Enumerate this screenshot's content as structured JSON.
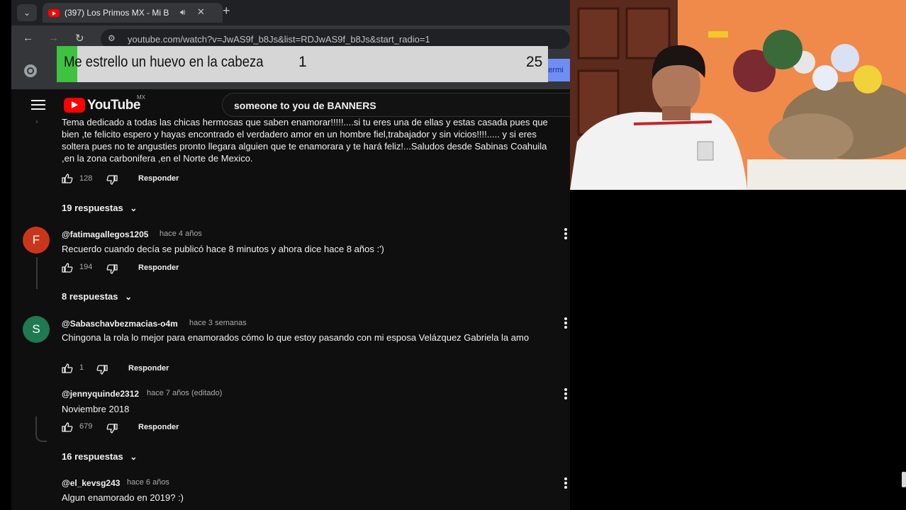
{
  "browser": {
    "tab_title": "(397) Los Primos MX - Mi B",
    "url": "youtube.com/watch?v=JwAS9f_b8Js&list=RDJwAS9f_b8Js&start_radio=1",
    "sidebar_hint": "determi"
  },
  "banner": {
    "text": "Me estrello un huevo en la cabeza",
    "count": "1",
    "total": "25"
  },
  "youtube": {
    "logo_text": "YouTube",
    "country": "MX",
    "search_value": "someone to you de BANNERS"
  },
  "comments": [
    {
      "text": "Tema dedicado a todas las chicas hermosas que saben enamorar!!!!!....si tu eres una de ellas y estas casada pues que bien ,te felicito espero y hayas encontrado el verdadero amor en un hombre fiel,trabajador y sin vicios!!!!..... y si eres soltera pues no te angusties pronto llegara alguien que te enamorara y te hará feliz!...Saludos desde Sabinas Coahuila ,en la zona carbonifera ,en el Norte de Mexico.",
      "likes": "128",
      "reply_label": "Responder",
      "replies_label": "19 respuestas"
    },
    {
      "author": "@fatimagallegos1205",
      "time": "hace 4 años",
      "avatar_letter": "F",
      "avatar_color": "#c9361b",
      "text": "Recuerdo cuando decía se publicó hace 8 minutos y ahora dice hace 8 años :')",
      "likes": "194",
      "reply_label": "Responder",
      "replies_label": "8 respuestas"
    },
    {
      "author": "@Sabaschavbezmacias-o4m",
      "time": "hace 3 semanas",
      "avatar_letter": "S",
      "avatar_color": "#1f7a4f",
      "text": "Chingona la rola lo mejor para enamorados cómo lo que estoy pasando con mi esposa Velázquez Gabriela la amo",
      "likes": "1",
      "reply_label": "Responder"
    },
    {
      "author": "@jennyquinde2312",
      "time": "hace 7 años (editado)",
      "text": "Noviembre 2018",
      "likes": "679",
      "reply_label": "Responder",
      "replies_label": "16 respuestas"
    },
    {
      "author": "@el_kevsg243",
      "time": "hace 6 años",
      "text": "Algun enamorado en 2019? :)"
    }
  ],
  "colors": {
    "youtube_red": "#ff0000",
    "page_bg": "#0f0f0f",
    "banner_green": "#3fc23f",
    "banner_bg": "#d6d6d6"
  }
}
